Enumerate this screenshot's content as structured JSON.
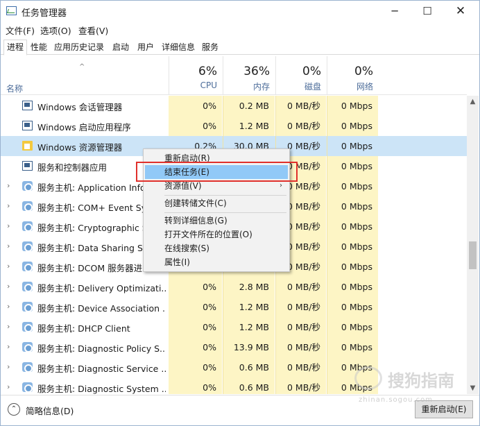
{
  "window": {
    "title": "任务管理器",
    "minimize_symbol": "─",
    "maximize_symbol": "☐",
    "close_symbol": "✕"
  },
  "menu": [
    "文件(F)",
    "选项(O)",
    "查看(V)"
  ],
  "tabs": [
    "进程",
    "性能",
    "应用历史记录",
    "启动",
    "用户",
    "详细信息",
    "服务"
  ],
  "active_tab": "进程",
  "header": {
    "sort_arrow": "^",
    "name_label": "名称",
    "cpu": {
      "percent": "6%",
      "label": "CPU"
    },
    "memory": {
      "percent": "36%",
      "label": "内存"
    },
    "disk": {
      "percent": "0%",
      "label": "磁盘"
    },
    "network": {
      "percent": "0%",
      "label": "网络"
    }
  },
  "rows": [
    {
      "name": "Windows 会话管理器",
      "cpu": "0%",
      "memory": "0.2 MB",
      "disk": "0 MB/秒",
      "network": "0 Mbps",
      "icon": "window-icon",
      "expandable": false
    },
    {
      "name": "Windows 启动应用程序",
      "cpu": "0%",
      "memory": "1.2 MB",
      "disk": "0 MB/秒",
      "network": "0 Mbps",
      "icon": "window-icon",
      "expandable": false
    },
    {
      "name": "Windows 资源管理器",
      "cpu": "0.2%",
      "memory": "30.0 MB",
      "disk": "0 MB/秒",
      "network": "0 Mbps",
      "icon": "folder-icon",
      "expandable": false,
      "selected": true
    },
    {
      "name": "服务和控制器应用",
      "cpu": "",
      "memory": "",
      "disk": "0 MB/秒",
      "network": "0 Mbps",
      "icon": "window-icon",
      "expandable": false
    },
    {
      "name": "服务主机: Application Info",
      "cpu": "",
      "memory": "",
      "disk": "0 MB/秒",
      "network": "0 Mbps",
      "icon": "gear-icon",
      "expandable": true
    },
    {
      "name": "服务主机: COM+ Event Sys",
      "cpu": "",
      "memory": "",
      "disk": "0 MB/秒",
      "network": "0 Mbps",
      "icon": "gear-icon",
      "expandable": true
    },
    {
      "name": "服务主机: Cryptographic S",
      "cpu": "",
      "memory": "",
      "disk": "0 MB/秒",
      "network": "0 Mbps",
      "icon": "gear-icon",
      "expandable": true
    },
    {
      "name": "服务主机: Data Sharing Se",
      "cpu": "",
      "memory": "",
      "disk": "0 MB/秒",
      "network": "0 Mbps",
      "icon": "gear-icon",
      "expandable": true
    },
    {
      "name": "服务主机: DCOM 服务器进",
      "cpu": "",
      "memory": "",
      "disk": "0 MB/秒",
      "network": "0 Mbps",
      "icon": "gear-icon",
      "expandable": true
    },
    {
      "name": "服务主机: Delivery Optimizati...",
      "cpu": "0%",
      "memory": "2.8 MB",
      "disk": "0 MB/秒",
      "network": "0 Mbps",
      "icon": "gear-icon",
      "expandable": true
    },
    {
      "name": "服务主机: Device Association ...",
      "cpu": "0%",
      "memory": "1.2 MB",
      "disk": "0 MB/秒",
      "network": "0 Mbps",
      "icon": "gear-icon",
      "expandable": true
    },
    {
      "name": "服务主机: DHCP Client",
      "cpu": "0%",
      "memory": "1.2 MB",
      "disk": "0 MB/秒",
      "network": "0 Mbps",
      "icon": "gear-icon",
      "expandable": true
    },
    {
      "name": "服务主机: Diagnostic Policy S...",
      "cpu": "0%",
      "memory": "13.9 MB",
      "disk": "0 MB/秒",
      "network": "0 Mbps",
      "icon": "gear-icon",
      "expandable": true
    },
    {
      "name": "服务主机: Diagnostic Service ...",
      "cpu": "0%",
      "memory": "0.6 MB",
      "disk": "0 MB/秒",
      "network": "0 Mbps",
      "icon": "gear-icon",
      "expandable": true
    },
    {
      "name": "服务主机: Diagnostic System ...",
      "cpu": "0%",
      "memory": "0.6 MB",
      "disk": "0 MB/秒",
      "network": "0 Mbps",
      "icon": "gear-icon",
      "expandable": true
    }
  ],
  "context_menu": {
    "items": [
      {
        "label": "重新启动(R)"
      },
      {
        "label": "结束任务(E)",
        "selected": true
      },
      {
        "label": "资源值(V)",
        "submenu": true,
        "submenu_symbol": "›"
      },
      {
        "label": "创建转储文件(C)"
      },
      {
        "label": "转到详细信息(G)"
      },
      {
        "label": "打开文件所在的位置(O)"
      },
      {
        "label": "在线搜索(S)"
      },
      {
        "label": "属性(I)"
      }
    ]
  },
  "footer": {
    "fewer_details_label": "简略信息(D)",
    "fewer_details_symbol": "⌃",
    "restart_button_label": "重新启动(E)"
  },
  "scrollbar": {
    "up_symbol": "▲",
    "down_symbol": "▼"
  },
  "watermark": {
    "text": "搜狗指南",
    "url": "zhinan.sogou.com"
  }
}
